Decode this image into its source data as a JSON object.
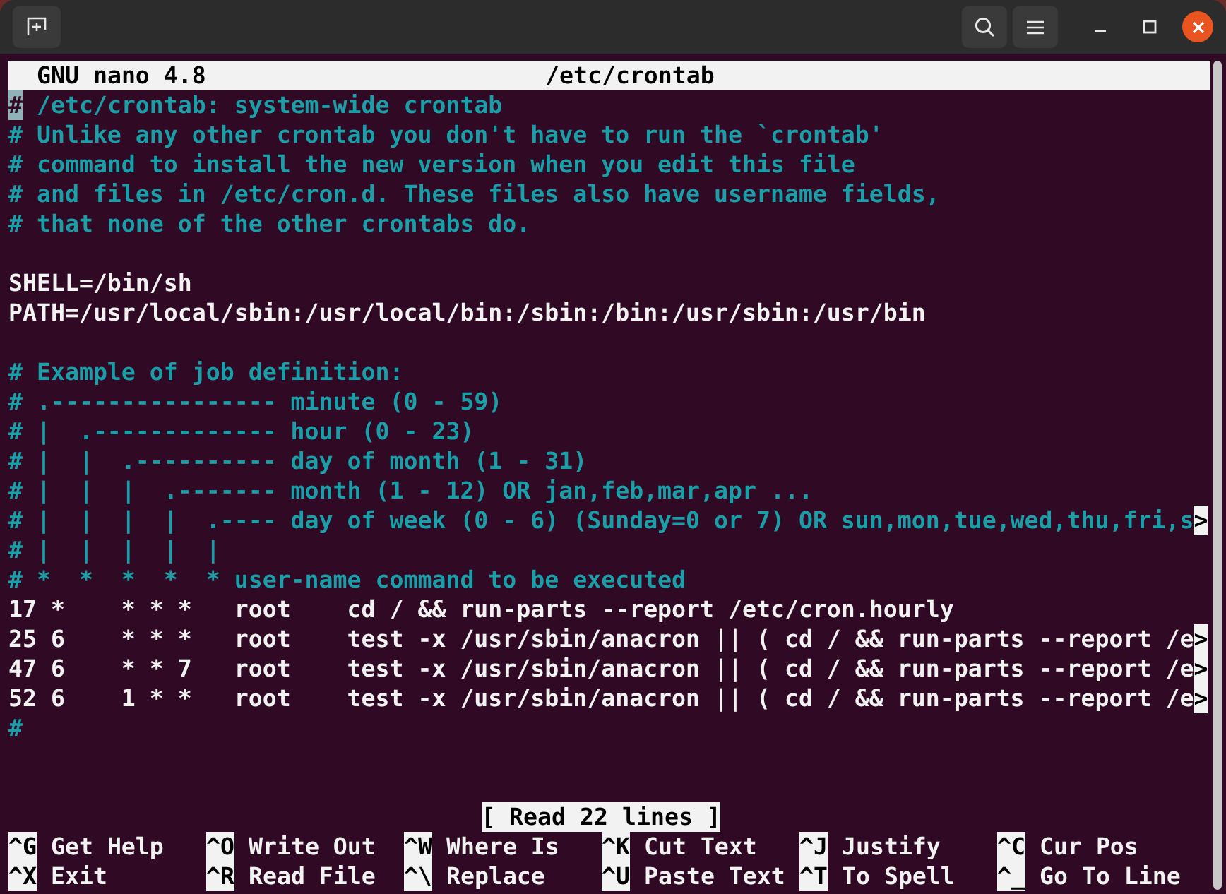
{
  "header": {
    "app": "GNU nano 4.8",
    "file": "/etc/crontab"
  },
  "lines": [
    {
      "kind": "comment",
      "text": "# /etc/crontab: system-wide crontab",
      "cursor": true
    },
    {
      "kind": "comment",
      "text": "# Unlike any other crontab you don't have to run the `crontab'"
    },
    {
      "kind": "comment",
      "text": "# command to install the new version when you edit this file"
    },
    {
      "kind": "comment",
      "text": "# and files in /etc/cron.d. These files also have username fields,"
    },
    {
      "kind": "comment",
      "text": "# that none of the other crontabs do."
    },
    {
      "kind": "blank"
    },
    {
      "kind": "code",
      "text": "SHELL=/bin/sh"
    },
    {
      "kind": "code",
      "text": "PATH=/usr/local/sbin:/usr/local/bin:/sbin:/bin:/usr/sbin:/usr/bin"
    },
    {
      "kind": "blank"
    },
    {
      "kind": "comment",
      "text": "# Example of job definition:"
    },
    {
      "kind": "comment",
      "text": "# .---------------- minute (0 - 59)"
    },
    {
      "kind": "comment",
      "text": "# |  .------------- hour (0 - 23)"
    },
    {
      "kind": "comment",
      "text": "# |  |  .---------- day of month (1 - 31)"
    },
    {
      "kind": "comment",
      "text": "# |  |  |  .------- month (1 - 12) OR jan,feb,mar,apr ..."
    },
    {
      "kind": "comment",
      "text": "# |  |  |  |  .---- day of week (0 - 6) (Sunday=0 or 7) OR sun,mon,tue,wed,thu,fri,s",
      "more": ">"
    },
    {
      "kind": "comment",
      "text": "# |  |  |  |  |"
    },
    {
      "kind": "comment",
      "text": "# *  *  *  *  * user-name command to be executed"
    },
    {
      "kind": "code",
      "text": "17 *    * * *   root    cd / && run-parts --report /etc/cron.hourly"
    },
    {
      "kind": "code",
      "text": "25 6    * * *   root    test -x /usr/sbin/anacron || ( cd / && run-parts --report /e",
      "more": ">"
    },
    {
      "kind": "code",
      "text": "47 6    * * 7   root    test -x /usr/sbin/anacron || ( cd / && run-parts --report /e",
      "more": ">"
    },
    {
      "kind": "code",
      "text": "52 6    1 * *   root    test -x /usr/sbin/anacron || ( cd / && run-parts --report /e",
      "more": ">"
    },
    {
      "kind": "comment",
      "text": "#"
    }
  ],
  "status": "[ Read 22 lines ]",
  "shortcuts": [
    {
      "key": "^G",
      "label": "Get Help"
    },
    {
      "key": "^O",
      "label": "Write Out"
    },
    {
      "key": "^W",
      "label": "Where Is"
    },
    {
      "key": "^K",
      "label": "Cut Text"
    },
    {
      "key": "^J",
      "label": "Justify"
    },
    {
      "key": "^C",
      "label": "Cur Pos"
    },
    {
      "key": "^X",
      "label": "Exit"
    },
    {
      "key": "^R",
      "label": "Read File"
    },
    {
      "key": "^\\",
      "label": "Replace"
    },
    {
      "key": "^U",
      "label": "Paste Text"
    },
    {
      "key": "^T",
      "label": "To Spell"
    },
    {
      "key": "^_",
      "label": "Go To Line"
    }
  ]
}
